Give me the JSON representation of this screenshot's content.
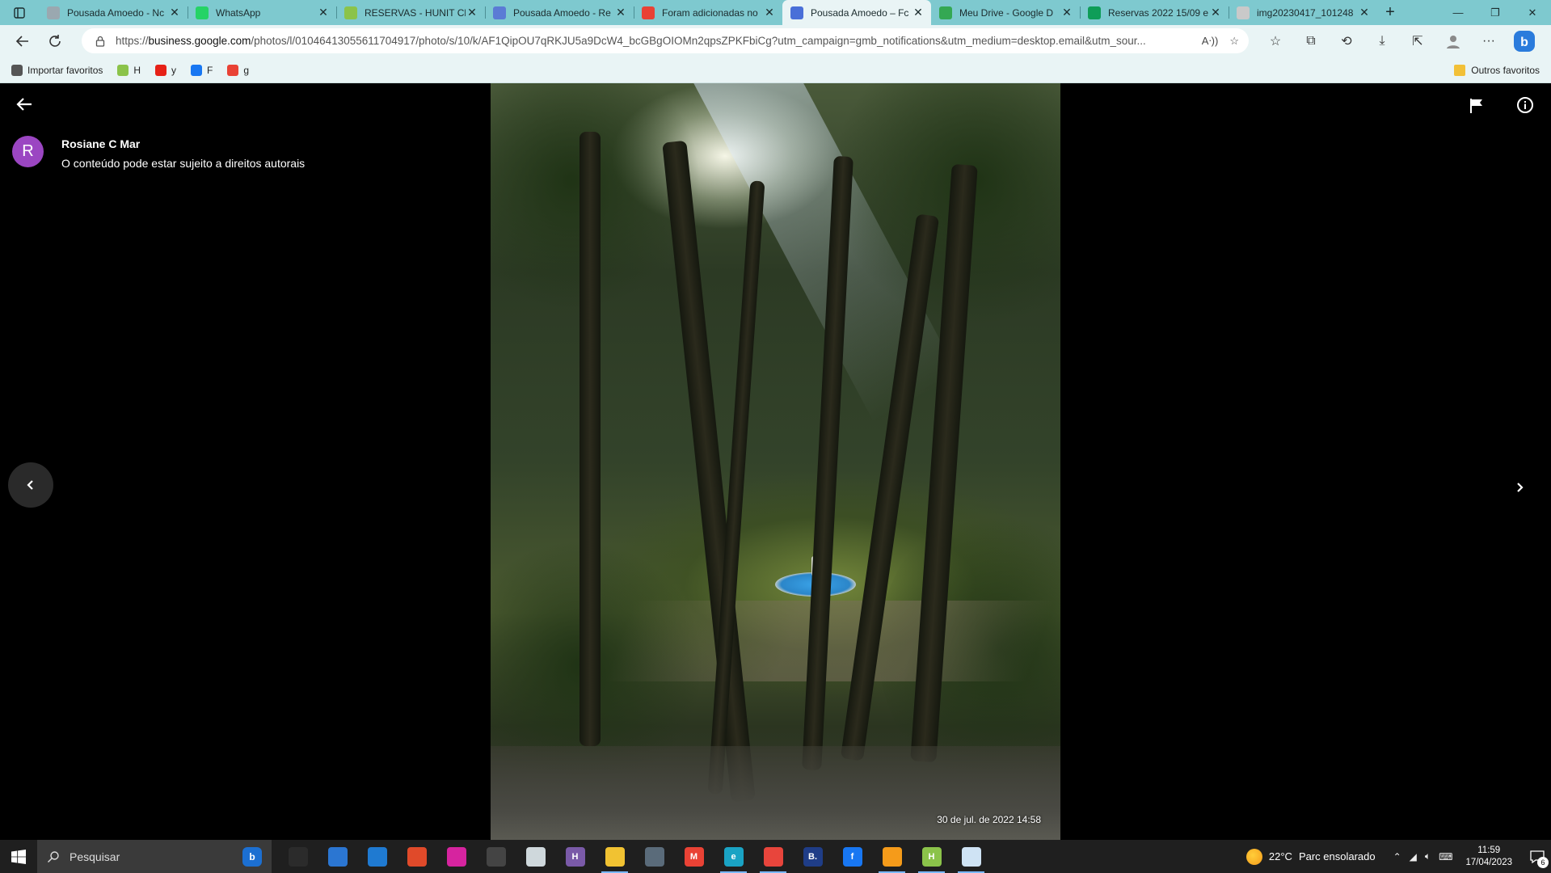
{
  "browser": {
    "tabs": [
      {
        "title": "Pousada Amoedo - Nc",
        "icon": "google-business-icon",
        "color": "#9aa8b0",
        "active": false
      },
      {
        "title": "WhatsApp",
        "icon": "whatsapp-icon",
        "color": "#25d366",
        "active": false
      },
      {
        "title": "RESERVAS - HUNIT Ch",
        "icon": "hunit-icon",
        "color": "#8bc34a",
        "active": false
      },
      {
        "title": "Pousada Amoedo - Re",
        "icon": "booking-icon",
        "color": "#5b7bd5",
        "active": false
      },
      {
        "title": "Foram adicionadas no",
        "icon": "gmail-icon",
        "color": "#e94235",
        "active": false
      },
      {
        "title": "Pousada Amoedo – Fc",
        "icon": "google-business-icon",
        "color": "#4a6fd8",
        "active": true
      },
      {
        "title": "Meu Drive - Google D",
        "icon": "google-drive-icon",
        "color": "#34a853",
        "active": false
      },
      {
        "title": "Reservas 2022 15/09 e",
        "icon": "google-sheets-icon",
        "color": "#0f9d58",
        "active": false
      },
      {
        "title": "img20230417_101248",
        "icon": "pdf-icon",
        "color": "#c9c9c9",
        "active": false
      }
    ],
    "address": {
      "prefix": "https://",
      "host": "business.google.com",
      "path": "/photos/l/01046413055611704917/photo/s/10/k/AF1QipOU7qRKJU5a9DcW4_bcGBgOIOMn2qpsZPKFbiCg?utm_campaign=gmb_notifications&utm_medium=desktop.email&utm_sour..."
    },
    "bookmarks": [
      {
        "label": "Importar favoritos",
        "icon": "import-icon",
        "color": "#555555"
      },
      {
        "label": "H",
        "icon": "hunit-icon",
        "color": "#8bc34a"
      },
      {
        "label": "y",
        "icon": "youtube-icon",
        "color": "#e62117"
      },
      {
        "label": "F",
        "icon": "facebook-icon",
        "color": "#1877f2"
      },
      {
        "label": "g",
        "icon": "gmail-icon",
        "color": "#e94235"
      }
    ],
    "other_bookmarks": "Outros favoritos"
  },
  "viewer": {
    "author_initial": "R",
    "author_name": "Rosiane C Mar",
    "copyright_note": "O conteúdo pode estar sujeito a direitos autorais",
    "photo_timestamp": "30 de jul. de 2022 14:58"
  },
  "taskbar": {
    "search_placeholder": "Pesquisar",
    "apps": [
      {
        "name": "task-view",
        "label": "",
        "color": "#2b2b2b",
        "running": false
      },
      {
        "name": "microsoft-store",
        "label": "",
        "color": "#2b76d2",
        "running": false
      },
      {
        "name": "mail",
        "label": "",
        "color": "#1f7ad1",
        "running": false
      },
      {
        "name": "app-red",
        "label": "",
        "color": "#e04a2a",
        "running": false
      },
      {
        "name": "instagram",
        "label": "",
        "color": "#d6249f",
        "running": false
      },
      {
        "name": "app-circle",
        "label": "",
        "color": "#444444",
        "running": false
      },
      {
        "name": "notepad",
        "label": "",
        "color": "#cfd8dc",
        "running": false
      },
      {
        "name": "hunit",
        "label": "H",
        "color": "#7a5aa8",
        "running": false
      },
      {
        "name": "file-explorer",
        "label": "",
        "color": "#f1c232",
        "running": true
      },
      {
        "name": "calculator",
        "label": "",
        "color": "#5a6b7a",
        "running": false
      },
      {
        "name": "gmail",
        "label": "M",
        "color": "#e94235",
        "running": false
      },
      {
        "name": "edge",
        "label": "e",
        "color": "#1aa3c4",
        "running": true
      },
      {
        "name": "chrome",
        "label": "",
        "color": "#e8453c",
        "running": true
      },
      {
        "name": "booking",
        "label": "B.",
        "color": "#1f3d87",
        "running": false
      },
      {
        "name": "facebook",
        "label": "f",
        "color": "#1877f2",
        "running": false
      },
      {
        "name": "weather-app",
        "label": "",
        "color": "#f59b1a",
        "running": true
      },
      {
        "name": "hunit-2",
        "label": "H",
        "color": "#8bc34a",
        "running": true
      },
      {
        "name": "document-viewer",
        "label": "",
        "color": "#cfe3f4",
        "running": true
      }
    ],
    "weather_temp": "22°C",
    "weather_text": "Parc ensolarado",
    "time": "11:59",
    "date": "17/04/2023",
    "notification_count": "6"
  }
}
